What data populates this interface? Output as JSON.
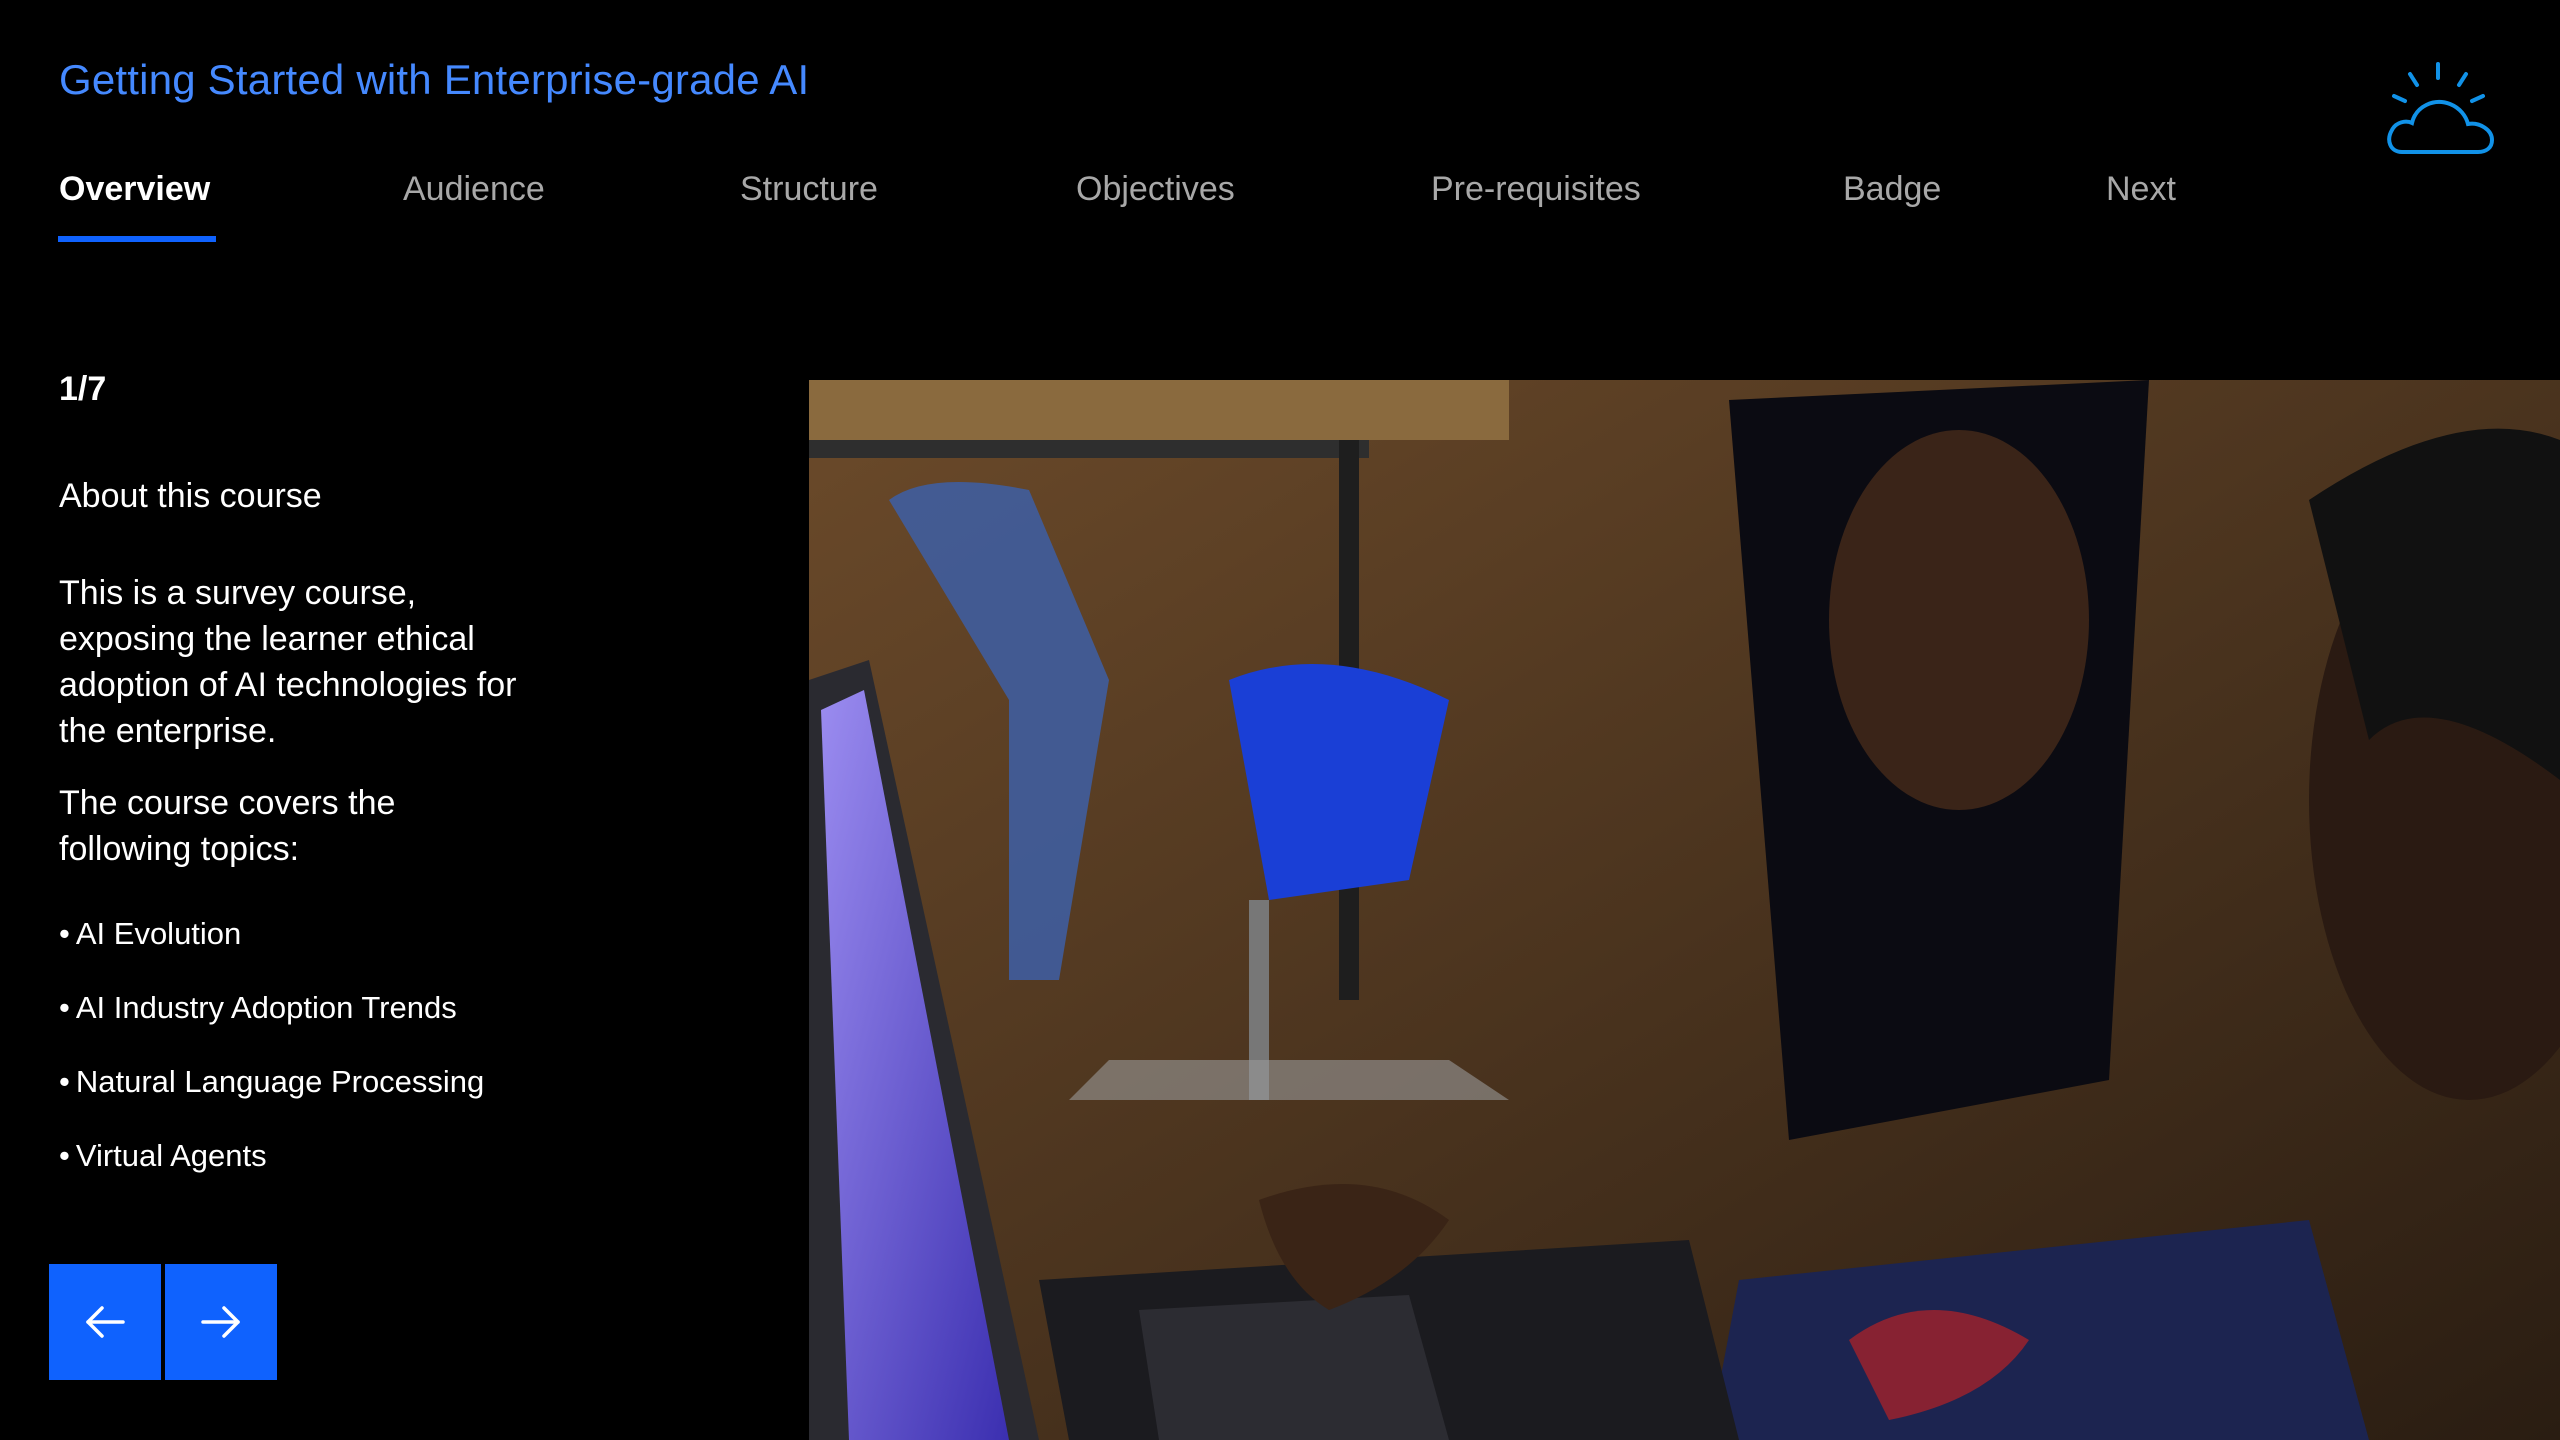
{
  "header": {
    "title": "Getting Started with Enterprise-grade AI",
    "logo_icon": "cloud-sun-icon",
    "accent_color": "#4589ff"
  },
  "tabs": [
    {
      "label": "Overview",
      "active": true
    },
    {
      "label": "Audience",
      "active": false
    },
    {
      "label": "Structure",
      "active": false
    },
    {
      "label": "Objectives",
      "active": false
    },
    {
      "label": "Pre-requisites",
      "active": false
    },
    {
      "label": "Badge",
      "active": false
    },
    {
      "label": "Next",
      "active": false
    }
  ],
  "content": {
    "counter": "1/7",
    "section_title": "About this course",
    "paragraphs": [
      "This is a survey course, exposing the learner ethical adoption of AI technologies for the enterprise.",
      "The course covers the following topics:"
    ],
    "topics": [
      "AI Evolution",
      "AI Industry Adoption Trends",
      "Natural Language Processing",
      "Virtual Agents"
    ]
  },
  "navigation": {
    "prev_icon": "arrow-left-icon",
    "next_icon": "arrow-right-icon",
    "button_color": "#0f62fe"
  },
  "hero_image": {
    "description_icon": "photo"
  }
}
